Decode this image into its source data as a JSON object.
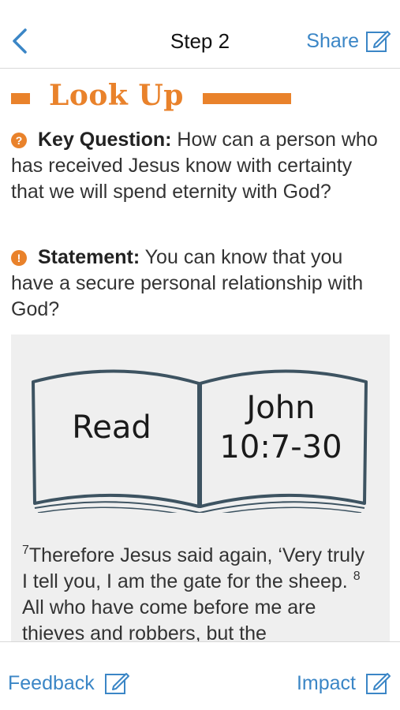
{
  "header": {
    "title": "Step 2",
    "share_label": "Share",
    "back_icon": "chevron-left-icon",
    "share_icon": "edit-icon"
  },
  "section": {
    "title": "Look Up",
    "accent_color": "#e9822b"
  },
  "key_question": {
    "icon": "question-icon",
    "label": "Key Question:",
    "text": " How can a person who has received Jesus know with certainty that we will spend eternity with God?"
  },
  "statement": {
    "icon": "exclamation-icon",
    "label": "Statement:",
    "text": " You can know that you have a secure personal relationship with God?"
  },
  "scripture_card": {
    "left_page": "Read",
    "right_page_line1": "John",
    "right_page_line2": "10:7-30",
    "verse_num_7": "7",
    "verse_7_text": "Therefore Jesus said again, ‘Very truly I tell you, I am the gate for the sheep. ",
    "verse_num_8": "8",
    "verse_8_text": "All who have come before me are thieves and robbers, but the"
  },
  "footer": {
    "feedback_label": "Feedback",
    "impact_label": "Impact",
    "link_color": "#3b86c6"
  }
}
